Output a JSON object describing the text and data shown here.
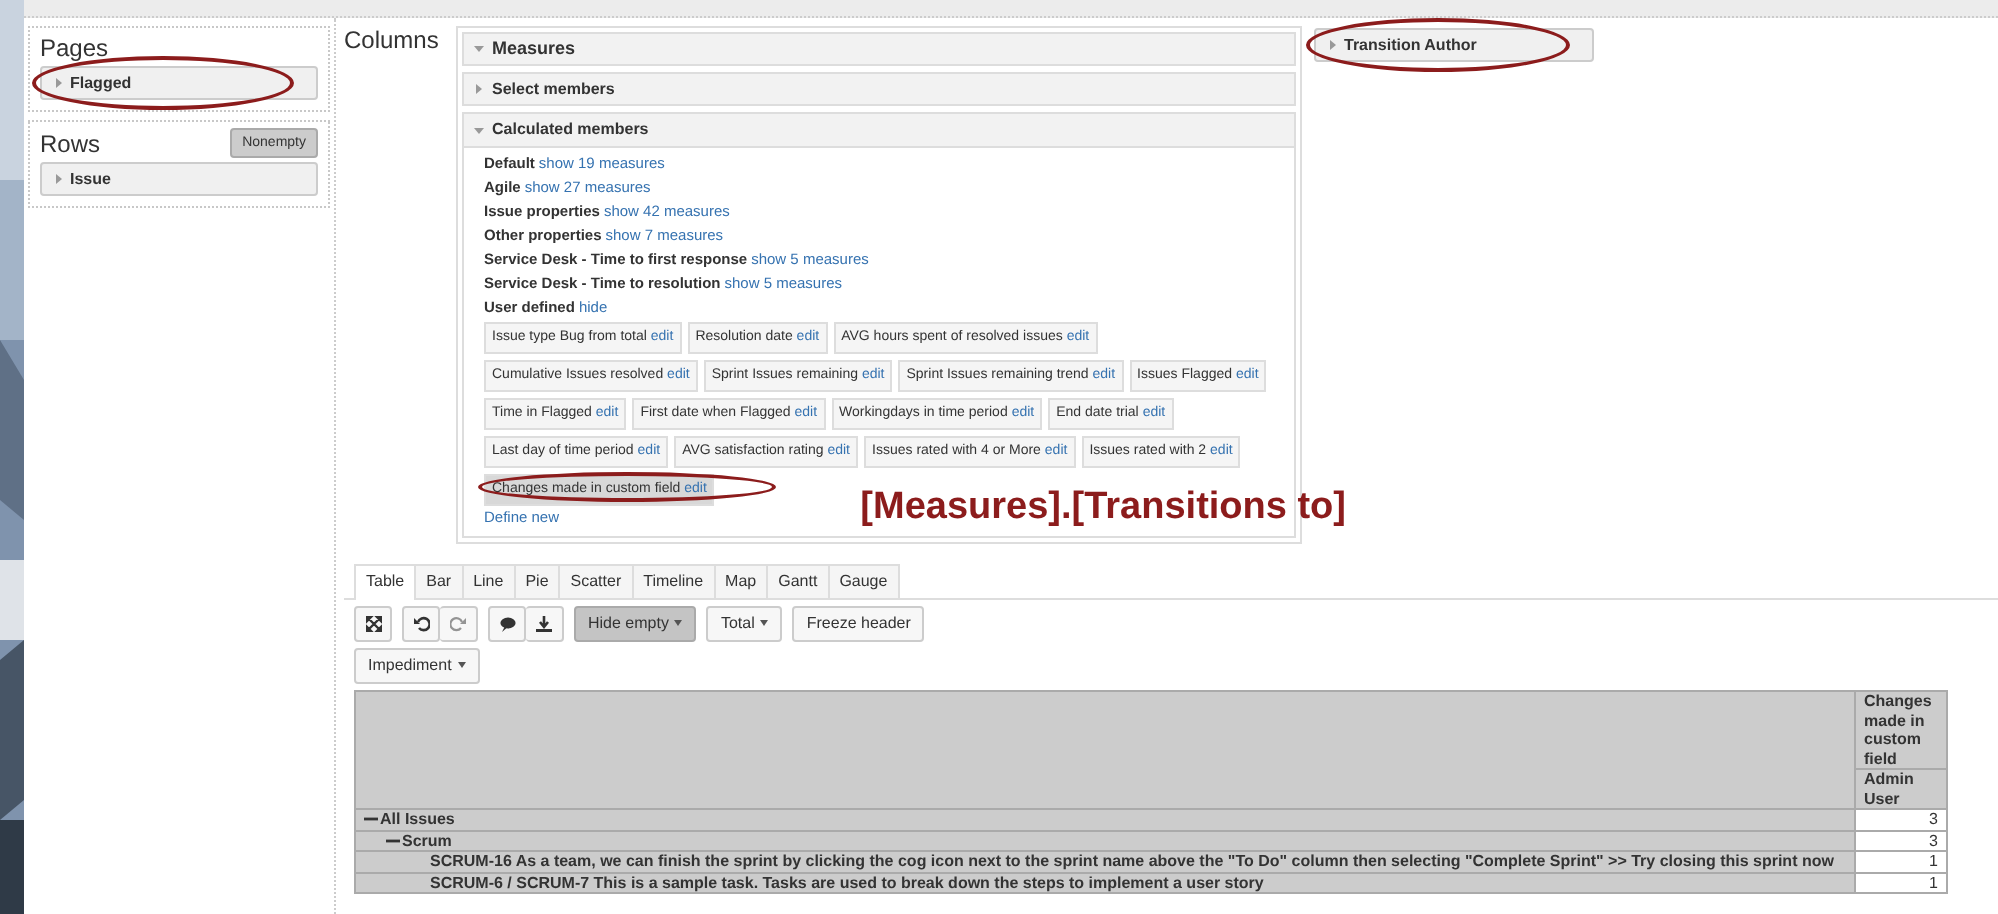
{
  "pages": {
    "title": "Pages",
    "items": [
      {
        "label": "Flagged",
        "circled": true
      }
    ]
  },
  "rows": {
    "title": "Rows",
    "nonempty_button": "Nonempty",
    "items": [
      {
        "label": "Issue",
        "circled": false
      }
    ]
  },
  "columns": {
    "title": "Columns",
    "measures": {
      "label": "Measures",
      "expanded": true,
      "select_members": {
        "label": "Select members",
        "expanded": false
      },
      "calculated_members": {
        "label": "Calculated members",
        "expanded": true,
        "groups": [
          {
            "name": "Default",
            "link": "show 19 measures"
          },
          {
            "name": "Agile",
            "link": "show 27 measures"
          },
          {
            "name": "Issue properties",
            "link": "show 42 measures"
          },
          {
            "name": "Other properties",
            "link": "show 7 measures"
          },
          {
            "name": "Service Desk - Time to first response",
            "link": "show 5 measures"
          },
          {
            "name": "Service Desk - Time to resolution",
            "link": "show 5 measures"
          },
          {
            "name": "User defined",
            "link": "hide"
          }
        ],
        "members": [
          {
            "label": "Issue type Bug from total",
            "link": "edit",
            "circled": false
          },
          {
            "label": "Resolution date",
            "link": "edit",
            "circled": false
          },
          {
            "label": "AVG hours spent of resolved issues",
            "link": "edit",
            "circled": false
          },
          {
            "label": "Cumulative Issues resolved",
            "link": "edit",
            "circled": false
          },
          {
            "label": "Sprint Issues remaining",
            "link": "edit",
            "circled": false
          },
          {
            "label": "Sprint Issues remaining trend",
            "link": "edit",
            "circled": false
          },
          {
            "label": "Issues Flagged",
            "link": "edit",
            "circled": false
          },
          {
            "label": "Time in Flagged",
            "link": "edit",
            "circled": false
          },
          {
            "label": "First date when Flagged",
            "link": "edit",
            "circled": false
          },
          {
            "label": "Workingdays in time period",
            "link": "edit",
            "circled": false
          },
          {
            "label": "End date trial",
            "link": "edit",
            "circled": false
          },
          {
            "label": "Last day of time period",
            "link": "edit",
            "circled": false
          },
          {
            "label": "AVG satisfaction rating",
            "link": "edit",
            "circled": false
          },
          {
            "label": "Issues rated with 4 or More",
            "link": "edit",
            "circled": false
          },
          {
            "label": "Issues rated with 2",
            "link": "edit",
            "circled": false
          },
          {
            "label": "Changes made in custom field",
            "link": "edit",
            "circled": true
          }
        ],
        "define_new": "Define new"
      }
    },
    "other_items": [
      {
        "label": "Transition Author",
        "circled": true
      }
    ]
  },
  "annotation": "[Measures].[Transitions to]",
  "view_tabs": [
    {
      "label": "Table",
      "selected": true
    },
    {
      "label": "Bar",
      "selected": false
    },
    {
      "label": "Line",
      "selected": false
    },
    {
      "label": "Pie",
      "selected": false
    },
    {
      "label": "Scatter",
      "selected": false
    },
    {
      "label": "Timeline",
      "selected": false
    },
    {
      "label": "Map",
      "selected": false
    },
    {
      "label": "Gantt",
      "selected": false
    },
    {
      "label": "Gauge",
      "selected": false
    }
  ],
  "toolbar": {
    "dropdowns": [
      {
        "label": "Hide empty",
        "pressed": true
      },
      {
        "label": "Total",
        "pressed": false
      }
    ],
    "freeze_button": "Freeze header",
    "filter_dropdown": "Impediment"
  },
  "table": {
    "column_header": "Changes made in custom field",
    "column_subheader": "Admin User",
    "rows": [
      {
        "label": "All Issues",
        "value": "3",
        "expanded": true,
        "children": [
          {
            "label": "Scrum",
            "value": "3",
            "expanded": true,
            "children": [
              {
                "label": "SCRUM-16 As a team, we can finish the sprint by clicking the cog icon next to the sprint name above the \"To Do\" column then selecting \"Complete Sprint\" >> Try closing this sprint now",
                "value": "1"
              },
              {
                "label": "SCRUM-6 / SCRUM-7 This is a sample task. Tasks are used to break down the steps to implement a user story",
                "value": "1"
              }
            ]
          }
        ]
      }
    ]
  }
}
